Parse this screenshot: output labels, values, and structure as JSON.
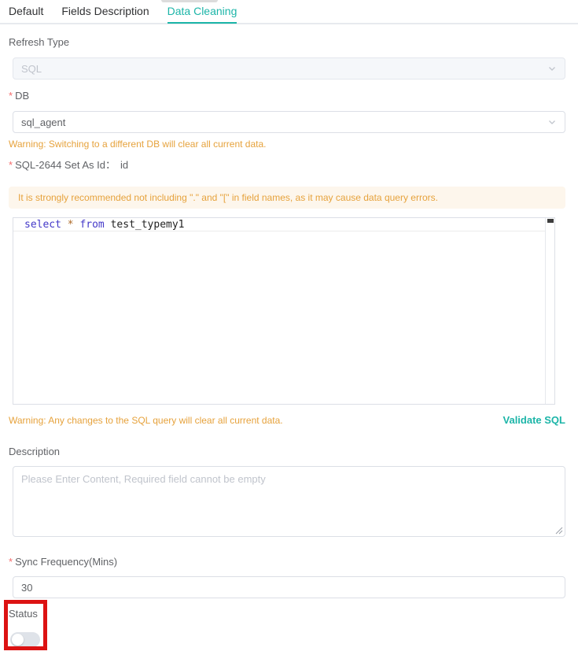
{
  "tabs": {
    "items": [
      {
        "label": "Default"
      },
      {
        "label": "Fields Description"
      },
      {
        "label": "Data Cleaning"
      }
    ],
    "active": "Data Cleaning"
  },
  "required_marker": "*",
  "refresh_type": {
    "label": "Refresh Type",
    "value": "SQL"
  },
  "db": {
    "label": "DB",
    "value": "sql_agent",
    "warning": "Warning: Switching to a different DB will clear all current data."
  },
  "sql": {
    "label": "SQL-2644 Set As Id：",
    "id_value": "id",
    "notice": "It is strongly recommended not including \".\" and \"[\" in field names, as it may cause data query errors.",
    "code": {
      "t1": "select",
      "t2": "*",
      "t3": "from",
      "t4": "test_typemy1"
    },
    "warning": "Warning: Any changes to the SQL query will clear all current data.",
    "validate_label": "Validate SQL"
  },
  "description": {
    "label": "Description",
    "placeholder": "Please Enter Content, Required field cannot be empty"
  },
  "sync_frequency": {
    "label": "Sync Frequency(Mins)",
    "value": "30"
  },
  "status": {
    "label": "Status",
    "value": "off"
  },
  "colors": {
    "accent": "#1CB5A8",
    "warning_text": "#E6A23C",
    "alert_bg": "#FDF6EC",
    "required": "#F56C6C",
    "annotation_box": "#DC1212",
    "disabled_bg": "#F5F7FA",
    "border": "#DCDFE6",
    "placeholder": "#C0C4CC"
  }
}
